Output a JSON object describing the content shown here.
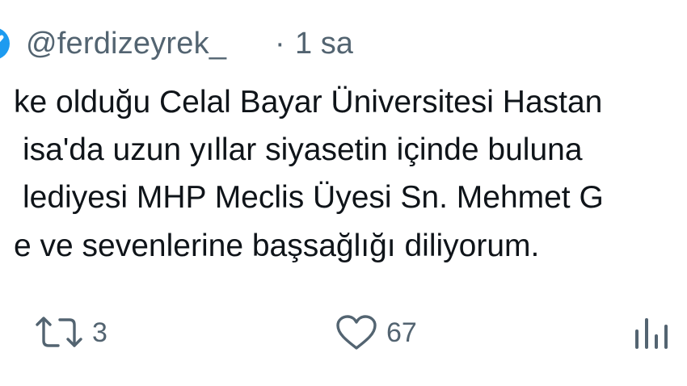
{
  "tweet": {
    "handle": "@ferdizeyrek_",
    "separator": "·",
    "time": "1 sa",
    "lines": [
      "ke olduğu Celal Bayar Üniversitesi Hastan",
      "isa'da uzun yıllar siyasetin içinde buluna",
      "lediyesi MHP Meclis Üyesi Sn. Mehmet G",
      "e ve sevenlerine başsağlığı diliyorum."
    ]
  },
  "actions": {
    "retweet_icon": "retweet-icon",
    "retweet_count": "3",
    "like_icon": "heart-icon",
    "like_count": "67",
    "views_icon": "bar-chart-icon"
  },
  "colors": {
    "text": "#0f1419",
    "muted": "#536471",
    "verified": "#1d9bf0"
  }
}
